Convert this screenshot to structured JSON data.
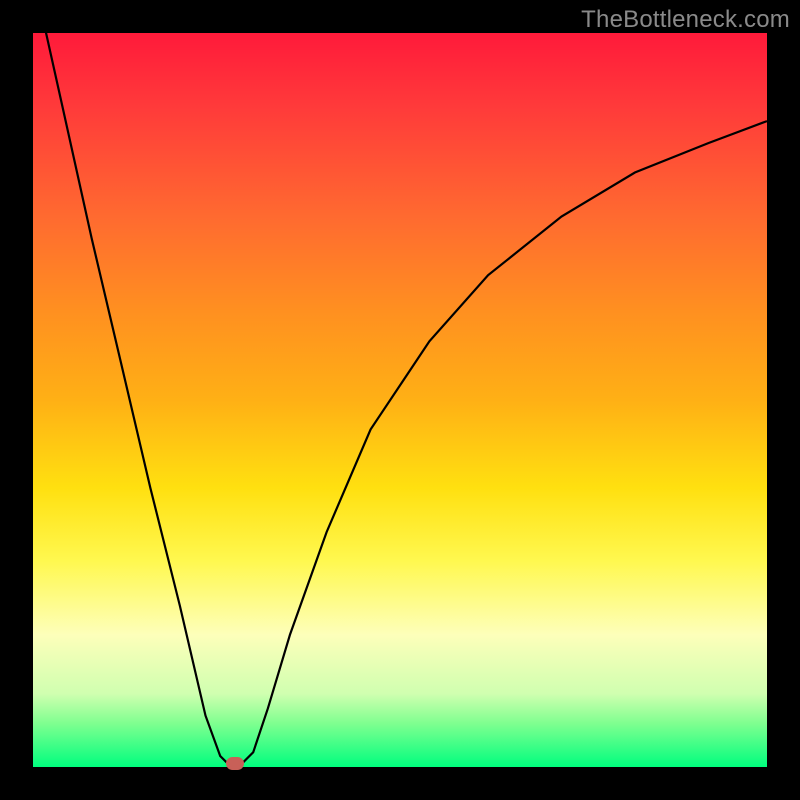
{
  "watermark": "TheBottleneck.com",
  "chart_data": {
    "type": "line",
    "title": "",
    "xlabel": "",
    "ylabel": "",
    "xlim": [
      0,
      1
    ],
    "ylim": [
      0,
      100
    ],
    "series": [
      {
        "name": "bottleneck-curve",
        "x": [
          0.0,
          0.04,
          0.08,
          0.12,
          0.16,
          0.2,
          0.235,
          0.255,
          0.27,
          0.28,
          0.3,
          0.32,
          0.35,
          0.4,
          0.46,
          0.54,
          0.62,
          0.72,
          0.82,
          0.92,
          1.0
        ],
        "values": [
          108,
          90,
          72,
          55,
          38,
          22,
          7,
          1.5,
          0,
          0,
          2,
          8,
          18,
          32,
          46,
          58,
          67,
          75,
          81,
          85,
          88
        ]
      }
    ],
    "marker": {
      "x": 0.275,
      "y": 0.5,
      "color": "#c86058"
    },
    "gradient": [
      "#ff1a3a",
      "#ff6a30",
      "#ffb015",
      "#fff850",
      "#00fe7e"
    ]
  }
}
